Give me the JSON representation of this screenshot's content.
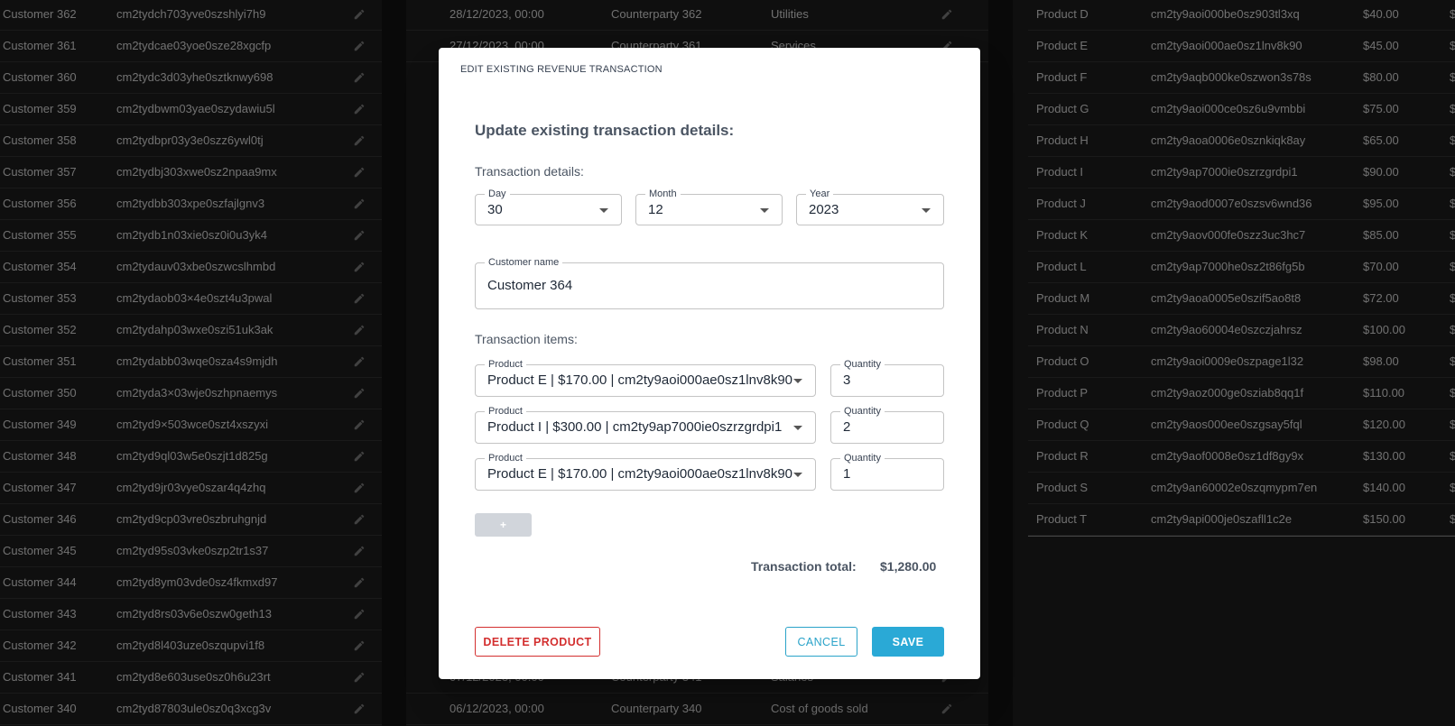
{
  "left_table": {
    "rows": [
      {
        "customer": "Customer 362",
        "id": "cm2tydch703yve0szshlyi7h9"
      },
      {
        "customer": "Customer 361",
        "id": "cm2tydcae03yoe0sze28xgcfp"
      },
      {
        "customer": "Customer 360",
        "id": "cm2tydc3d03yhe0sztknwy698"
      },
      {
        "customer": "Customer 359",
        "id": "cm2tydbwm03yae0szydawiu5l"
      },
      {
        "customer": "Customer 358",
        "id": "cm2tydbpr03y3e0szz6ywl0tj"
      },
      {
        "customer": "Customer 357",
        "id": "cm2tydbj303xwe0sz2npaa9mx"
      },
      {
        "customer": "Customer 356",
        "id": "cm2tydbb303xpe0szfajlgnv3"
      },
      {
        "customer": "Customer 355",
        "id": "cm2tydb1n03xie0sz0i0u3yk4"
      },
      {
        "customer": "Customer 354",
        "id": "cm2tydauv03xbe0szwcslhmbd"
      },
      {
        "customer": "Customer 353",
        "id": "cm2tydaob03×4e0szt4u3pwal"
      },
      {
        "customer": "Customer 352",
        "id": "cm2tydahp03wxe0szi51uk3ak"
      },
      {
        "customer": "Customer 351",
        "id": "cm2tydabb03wqe0sza4s9mjdh"
      },
      {
        "customer": "Customer 350",
        "id": "cm2tyda3×03wje0szhpnaemys"
      },
      {
        "customer": "Customer 349",
        "id": "cm2tyd9×503wce0szt4xszyxi"
      },
      {
        "customer": "Customer 348",
        "id": "cm2tyd9ql03w5e0szjt1d825g"
      },
      {
        "customer": "Customer 347",
        "id": "cm2tyd9jr03vye0szar4q4zhq"
      },
      {
        "customer": "Customer 346",
        "id": "cm2tyd9cp03vre0szbruhgnjd"
      },
      {
        "customer": "Customer 345",
        "id": "cm2tyd95s03vke0szp2tr1s37"
      },
      {
        "customer": "Customer 344",
        "id": "cm2tyd8ym03vde0sz4fkmxd97"
      },
      {
        "customer": "Customer 343",
        "id": "cm2tyd8rs03v6e0szw0geth13"
      },
      {
        "customer": "Customer 342",
        "id": "cm2tyd8l403uze0szqupvi1f8"
      },
      {
        "customer": "Customer 341",
        "id": "cm2tyd8e603use0sz0h6u23rt"
      },
      {
        "customer": "Customer 340",
        "id": "cm2tyd87803ule0sz0q3xcg3v"
      }
    ]
  },
  "middle_table": {
    "rows": [
      {
        "date": "28/12/2023, 00:00",
        "counterparty": "Counterparty 362",
        "category": "Utilities"
      },
      {
        "date": "27/12/2023, 00:00",
        "counterparty": "Counterparty 361",
        "category": "Services"
      },
      {
        "date": "07/12/2023, 00:00",
        "counterparty": "Counterparty 341",
        "category": "Salaries"
      },
      {
        "date": "06/12/2023, 00:00",
        "counterparty": "Counterparty 340",
        "category": "Cost of goods sold"
      }
    ]
  },
  "right_table": {
    "rows": [
      {
        "product": "Product D",
        "id": "cm2ty9aoi000be0sz903tl3xq",
        "price": "$40.00",
        "extra": "$"
      },
      {
        "product": "Product E",
        "id": "cm2ty9aoi000ae0sz1lnv8k90",
        "price": "$45.00",
        "extra": "$"
      },
      {
        "product": "Product F",
        "id": "cm2ty9aqb000ke0szwon3s78s",
        "price": "$80.00",
        "extra": "$"
      },
      {
        "product": "Product G",
        "id": "cm2ty9aoi000ce0sz6u9vmbbi",
        "price": "$75.00",
        "extra": "$"
      },
      {
        "product": "Product H",
        "id": "cm2ty9aoa0006e0sznkiqk8ay",
        "price": "$65.00",
        "extra": "$2"
      },
      {
        "product": "Product I",
        "id": "cm2ty9ap7000ie0szrzgrdpi1",
        "price": "$90.00",
        "extra": "$3"
      },
      {
        "product": "Product J",
        "id": "cm2ty9aod0007e0szsv6wnd36",
        "price": "$95.00",
        "extra": "$3"
      },
      {
        "product": "Product K",
        "id": "cm2ty9aov000fe0szz3uc3hc7",
        "price": "$85.00",
        "extra": "$2"
      },
      {
        "product": "Product L",
        "id": "cm2ty9ap7000he0sz2t86fg5b",
        "price": "$70.00",
        "extra": "$2"
      },
      {
        "product": "Product M",
        "id": "cm2ty9aoa0005e0szif5ao8t8",
        "price": "$72.00",
        "extra": "$2"
      },
      {
        "product": "Product N",
        "id": "cm2ty9ao60004e0szczjahrsz",
        "price": "$100.00",
        "extra": "$3"
      },
      {
        "product": "Product O",
        "id": "cm2ty9aoi0009e0szpage1l32",
        "price": "$98.00",
        "extra": "$3"
      },
      {
        "product": "Product P",
        "id": "cm2ty9aoz000ge0sziab8qq1f",
        "price": "$110.00",
        "extra": "$3"
      },
      {
        "product": "Product Q",
        "id": "cm2ty9aos000ee0szgsay5fql",
        "price": "$120.00",
        "extra": "$4"
      },
      {
        "product": "Product R",
        "id": "cm2ty9aof0008e0sz1df8gy9x",
        "price": "$130.00",
        "extra": "$4"
      },
      {
        "product": "Product S",
        "id": "cm2ty9an60002e0szqmypm7en",
        "price": "$140.00",
        "extra": "$4"
      },
      {
        "product": "Product T",
        "id": "cm2ty9api000je0szafll1c2e",
        "price": "$150.00",
        "extra": "$5"
      }
    ]
  },
  "modal": {
    "title": "EDIT EXISTING REVENUE TRANSACTION",
    "heading": "Update existing transaction details:",
    "details_label": "Transaction details:",
    "day": {
      "label": "Day",
      "value": "30"
    },
    "month": {
      "label": "Month",
      "value": "12"
    },
    "year": {
      "label": "Year",
      "value": "2023"
    },
    "customer": {
      "label": "Customer name",
      "value": "Customer 364"
    },
    "items_label": "Transaction items:",
    "items": [
      {
        "product_label": "Product",
        "product": "Product E | $170.00 | cm2ty9aoi000ae0sz1lnv8k90",
        "quantity_label": "Quantity",
        "quantity": "3"
      },
      {
        "product_label": "Product",
        "product": "Product I | $300.00 | cm2ty9ap7000ie0szrzgrdpi1",
        "quantity_label": "Quantity",
        "quantity": "2"
      },
      {
        "product_label": "Product",
        "product": "Product E | $170.00 | cm2ty9aoi000ae0sz1lnv8k90",
        "quantity_label": "Quantity",
        "quantity": "1"
      }
    ],
    "add_label": "+",
    "total_label": "Transaction total:",
    "total_value": "$1,280.00",
    "delete_label": "DELETE PRODUCT",
    "cancel_label": "CANCEL",
    "save_label": "SAVE"
  },
  "colors": {
    "accent": "#2aa9d6",
    "danger": "#d32f2f",
    "backdrop": "#121212"
  }
}
